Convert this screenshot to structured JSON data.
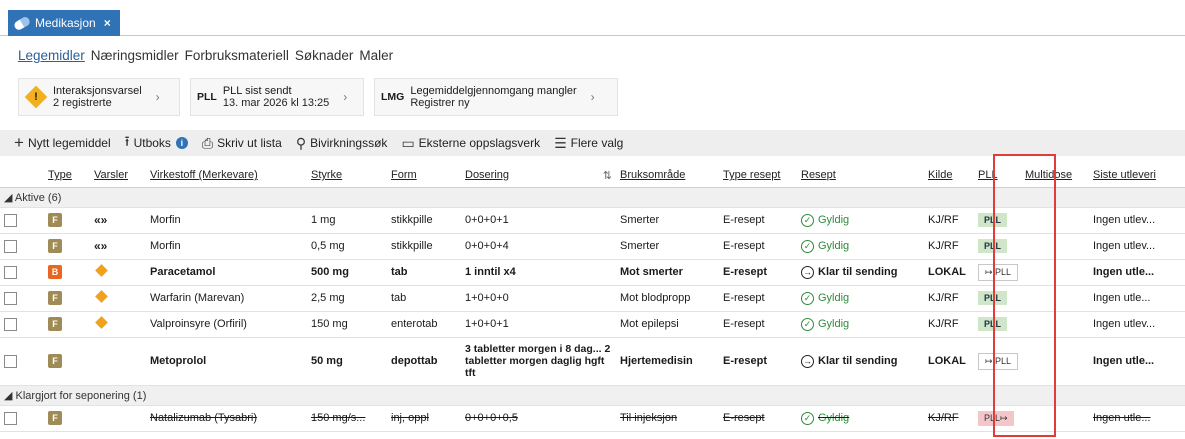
{
  "app_tab": {
    "label": "Medikasjon",
    "close": "×"
  },
  "subtabs": [
    "Legemidler",
    "Næringsmidler",
    "Forbruksmateriell",
    "Søknader",
    "Maler"
  ],
  "notices": [
    {
      "tag": "",
      "line1": "Interaksjonsvarsel",
      "line2": "2 registrerte"
    },
    {
      "tag": "PLL",
      "line1": "PLL sist sendt",
      "line2": "13. mar 2026 kl 13:25"
    },
    {
      "tag": "LMG",
      "line1": "Legemiddelgjennomgang mangler",
      "line2": "Registrer ny"
    }
  ],
  "notice_warn_glyph": "!",
  "chevron": "›",
  "toolbar": {
    "new": "Nytt legemiddel",
    "utboks": "Utboks",
    "utboks_badge": "i",
    "print": "Skriv ut lista",
    "side_effects": "Bivirkningssøk",
    "external": "Eksterne oppslagsverk",
    "more": "Flere valg"
  },
  "columns": [
    "",
    "Type",
    "Varsler",
    "Virkestoff (Merkevare)",
    "Styrke",
    "Form",
    "Dosering",
    "Bruksområde",
    "Type resept",
    "Resept",
    "Kilde",
    "PLL",
    "Multidose",
    "Siste utleveri"
  ],
  "groups": {
    "active": "◢ Aktive  (6)",
    "seponering": "◢ Klargjort for seponering  (1)"
  },
  "rows": [
    {
      "type": "F",
      "warn": "interaction",
      "warn_glyph": "«»",
      "name": "Morfin",
      "strength": "1 mg",
      "form": "stikkpille",
      "dose": "0+0+0+1",
      "use": "Smerter",
      "rtype": "E-resept",
      "status": "Gyldig",
      "source": "KJ/RF",
      "pll": "PLL",
      "last": "Ingen utlev..."
    },
    {
      "type": "F",
      "warn": "interaction",
      "warn_glyph": "«»",
      "name": "Morfin",
      "strength": "0,5 mg",
      "form": "stikkpille",
      "dose": "0+0+0+4",
      "use": "Smerter",
      "rtype": "E-resept",
      "status": "Gyldig",
      "source": "KJ/RF",
      "pll": "PLL",
      "last": "Ingen utlev..."
    },
    {
      "type": "B",
      "warn": "diamond",
      "name": "Paracetamol",
      "strength": "500 mg",
      "form": "tab",
      "dose": "1 inntil x4",
      "use": "Mot smerter",
      "rtype": "E-resept",
      "status": "Klar til sending",
      "source": "LOKAL",
      "pll": "↦ PLL",
      "last": "Ingen utle..."
    },
    {
      "type": "F",
      "warn": "diamond",
      "name": "Warfarin  (Marevan)",
      "strength": "2,5 mg",
      "form": "tab",
      "dose": "1+0+0+0",
      "use": "Mot blodpropp",
      "rtype": "E-resept",
      "status": "Gyldig",
      "source": "KJ/RF",
      "pll": "PLL",
      "last": "Ingen utle..."
    },
    {
      "type": "F",
      "warn": "diamond",
      "name": "Valproinsyre  (Orfiril)",
      "strength": "150 mg",
      "form": "enterotab",
      "dose": "1+0+0+1",
      "use": "Mot epilepsi",
      "rtype": "E-resept",
      "status": "Gyldig",
      "source": "KJ/RF",
      "pll": "PLL",
      "last": "Ingen utlev..."
    },
    {
      "type": "F",
      "warn": "",
      "name": "Metoprolol",
      "strength": "50 mg",
      "form": "depottab",
      "dose": "3 tabletter morgen i 8 dag... 2 tabletter morgen daglig hgft tft",
      "use": "Hjertemedisin",
      "rtype": "E-resept",
      "status": "Klar til sending",
      "source": "LOKAL",
      "pll": "↦ PLL",
      "last": "Ingen utle..."
    },
    {
      "type": "F",
      "warn": "",
      "name": "Natalizumab  (Tysabri)",
      "strength": "150 mg/s...",
      "form": "inj, oppl",
      "dose": "0+0+0+0,5",
      "use": "Til injeksjon",
      "rtype": "E-resept",
      "status": "Gyldig",
      "source": "KJ/RF",
      "pll": "PLL↦",
      "last": "Ingen utle..."
    }
  ],
  "status_ok_glyph": "✓",
  "status_send_glyph": "→"
}
